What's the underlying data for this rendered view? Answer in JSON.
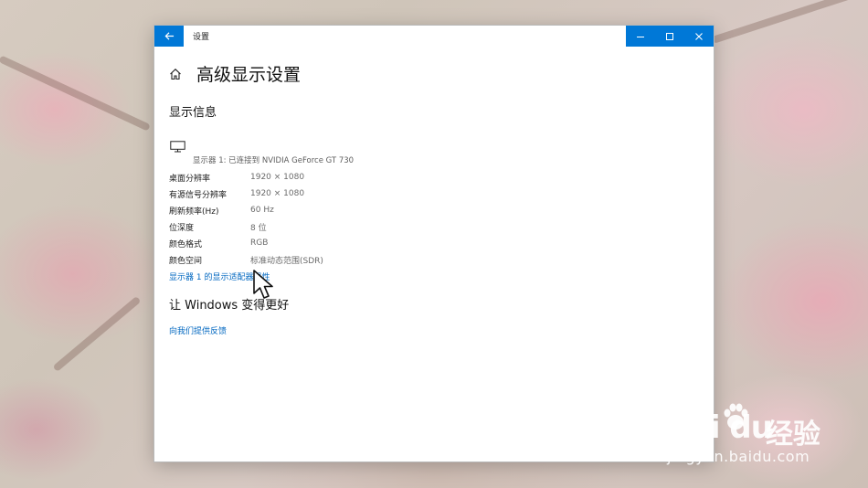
{
  "window": {
    "title": "设置",
    "back_icon": "back-arrow-icon",
    "controls": [
      "minimize-icon",
      "maximize-icon",
      "close-icon"
    ],
    "accent_color": "#0078d7"
  },
  "header": {
    "home_icon": "home-icon",
    "title": "高级显示设置"
  },
  "display_info": {
    "section_title": "显示信息",
    "monitor_icon": "monitor-icon",
    "monitor_label": "显示器 1: 已连接到 NVIDIA GeForce GT 730",
    "rows": [
      {
        "key": "桌面分辨率",
        "value": "1920 × 1080"
      },
      {
        "key": "有源信号分辨率",
        "value": "1920 × 1080"
      },
      {
        "key": "刷新频率(Hz)",
        "value": "60 Hz"
      },
      {
        "key": "位深度",
        "value": "8 位"
      },
      {
        "key": "颜色格式",
        "value": "RGB"
      },
      {
        "key": "颜色空间",
        "value": "标准动态范围(SDR)"
      }
    ],
    "adapter_link": "显示器 1 的显示适配器属性",
    "link_color": "#0067c0"
  },
  "windows_better": {
    "section_title": "让 Windows 变得更好",
    "feedback_link": "向我们提供反馈"
  },
  "watermark": {
    "logo_text": "Bai du",
    "logo_cn": "经验",
    "url": "jingyan.baidu.com"
  }
}
